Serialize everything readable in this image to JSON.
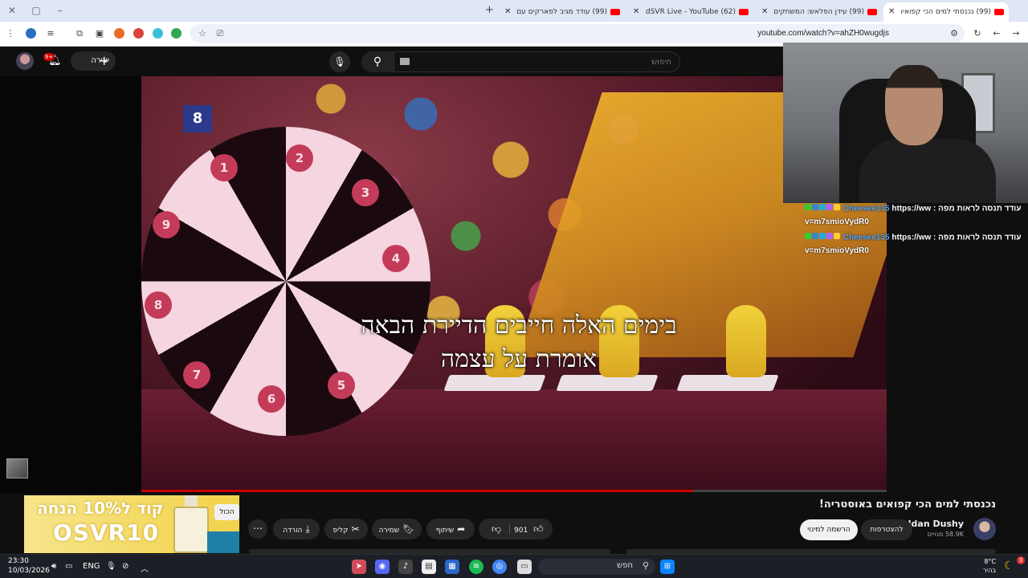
{
  "browser": {
    "tabs": [
      {
        "title": "(99) נכנסתי למים הכי קפואים ב",
        "active": true
      },
      {
        "title": "(99) עידן הפלאש: המשחקים שי"
      },
      {
        "title": "(62) OdedSVR Live - YouTube"
      },
      {
        "title": "(99) עודד מגיב לפארקים עם הו"
      }
    ],
    "url": "youtube.com/watch?v=ahZH0wugdjs"
  },
  "youtube": {
    "notification_count": "9+",
    "create_label": "יצירה",
    "search_placeholder": "חיפוש"
  },
  "video": {
    "counter": "8",
    "wheel_numbers": [
      "1",
      "2",
      "3",
      "4",
      "5",
      "6",
      "7",
      "8",
      "9"
    ],
    "subtitle_line1": "בימים האלה חייבים הדיירת הבאה",
    "subtitle_line2": "אומרת על עצמה",
    "progress": 0.74
  },
  "chat": [
    {
      "user": "Cheesee135",
      "message": "עודד תנסה לראות מפה : https://ww",
      "continuation": "v=m7smioVydR0"
    },
    {
      "user": "Cheesee135",
      "message": "עודד תנסה לראות מפה : https://ww",
      "continuation": "v=m7smioVydR0"
    }
  ],
  "ad": {
    "line1": "קוד ל10% הנחה",
    "line2": "OSVR10",
    "tooltip": "הכול"
  },
  "meta": {
    "title": "נכנסתי למים הכי קפואים באוסטריה!",
    "channel": "Idan Dushy",
    "subscribers": "58.9K מנויים",
    "join_label": "להצטרפות",
    "subscribe_label": "הרשמה למינוי",
    "like_count": "901",
    "share_label": "שיתוף",
    "save_label": "שמירה",
    "clip_label": "קליפ",
    "download_label": "הורדה"
  },
  "taskbar": {
    "time": "23:30",
    "date": "10/03/2026",
    "language": "ENG",
    "search_label": "חפש",
    "temperature": "8°C",
    "weather": "בהיר",
    "weather_badge": "3"
  }
}
